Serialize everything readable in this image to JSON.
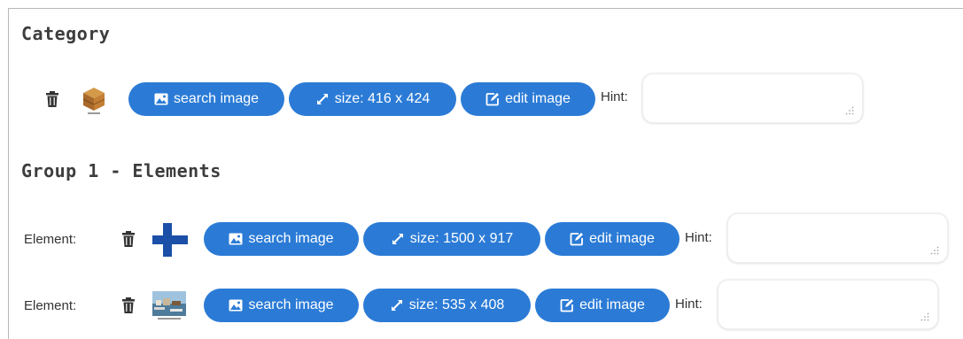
{
  "category": {
    "title": "Category",
    "row": {
      "search_label": "search image",
      "size_label": "size: 416 x 424",
      "edit_label": "edit image",
      "hint_label": "Hint:",
      "hint_value": ""
    }
  },
  "group": {
    "title": "Group 1 - Elements",
    "elements": [
      {
        "label": "Element:",
        "search_label": "search image",
        "size_label": "size: 1500 x 917",
        "edit_label": "edit image",
        "hint_label": "Hint:",
        "hint_value": ""
      },
      {
        "label": "Element:",
        "search_label": "search image",
        "size_label": "size: 535 x 408",
        "edit_label": "edit image",
        "hint_label": "Hint:",
        "hint_value": ""
      }
    ]
  },
  "colors": {
    "button_bg": "#2b7bd6",
    "button_text": "#ffffff",
    "title_text": "#3d3d3d"
  },
  "icons": [
    "trash-icon",
    "image-icon",
    "resize-icon",
    "edit-icon"
  ]
}
